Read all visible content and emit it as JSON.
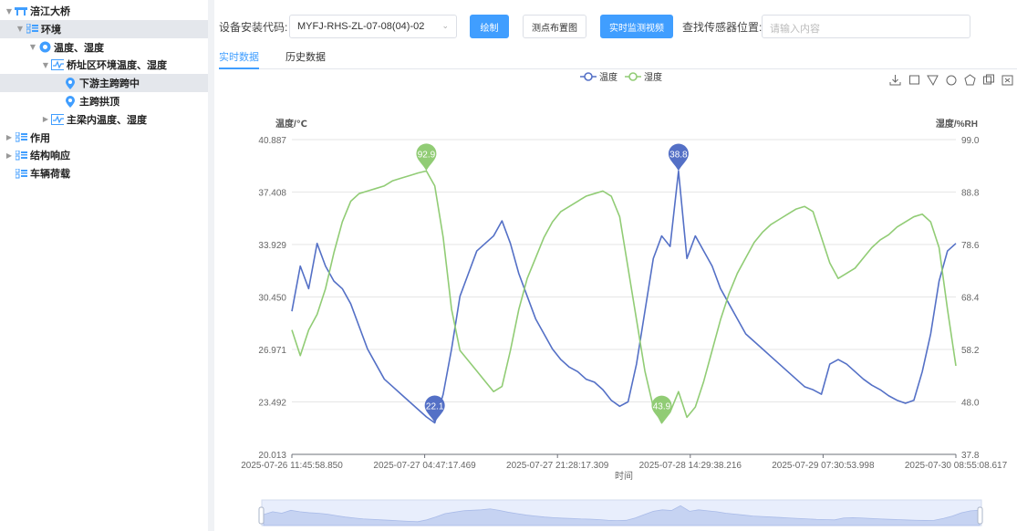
{
  "tree": [
    {
      "label": "涪江大桥",
      "level": 0,
      "caret": "▼",
      "icon": "bridge-icon",
      "selected": false
    },
    {
      "label": "环境",
      "level": 1,
      "caret": "▼",
      "icon": "list-icon",
      "selected": true
    },
    {
      "label": "温度、湿度",
      "level": 2,
      "caret": "▼",
      "icon": "thermo-hub-icon",
      "selected": false
    },
    {
      "label": "桥址区环境温度、湿度",
      "level": 3,
      "caret": "▼",
      "icon": "pulse-icon",
      "selected": false
    },
    {
      "label": "下游主跨跨中",
      "level": 4,
      "caret": "",
      "icon": "location-pin-icon",
      "selected": true
    },
    {
      "label": "主跨拱顶",
      "level": 4,
      "caret": "",
      "icon": "location-pin-icon",
      "selected": false
    },
    {
      "label": "主梁内温度、湿度",
      "level": 3,
      "caret": "▶",
      "icon": "pulse-icon",
      "selected": false
    },
    {
      "label": "作用",
      "level": 0,
      "caret": "▶",
      "icon": "list-icon",
      "selected": false
    },
    {
      "label": "结构响应",
      "level": 0,
      "caret": "▶",
      "icon": "list-icon",
      "selected": false
    },
    {
      "label": "车辆荷载",
      "level": 0,
      "caret": "",
      "icon": "list-icon",
      "selected": false
    }
  ],
  "toolbar": {
    "device_label": "设备安装代码:",
    "device_value": "MYFJ-RHS-ZL-07-08(04)-02",
    "draw_label": "绘制",
    "layout_label": "测点布置图",
    "video_label": "实时监测视频",
    "find_label": "查找传感器位置:",
    "search_placeholder": "请输入内容"
  },
  "tabs": [
    {
      "label": "实时数据",
      "active": true
    },
    {
      "label": "历史数据",
      "active": false
    }
  ],
  "colors": {
    "accent": "#409eff",
    "temp": "#5470c6",
    "humid": "#91cc75"
  },
  "chart_data": {
    "type": "line",
    "xlabel": "时间",
    "x_ticks": [
      "2025-07-26 11:45:58.850",
      "2025-07-27 04:47:17.469",
      "2025-07-27 21:28:17.309",
      "2025-07-28 14:29:38.216",
      "2025-07-29 07:30:53.998",
      "2025-07-30 08:55:08.617"
    ],
    "y_left": {
      "label": "温度/℃",
      "ylim": [
        20.013,
        40.887
      ],
      "ticks": [
        "20.013",
        "23.492",
        "26.971",
        "30.450",
        "33.929",
        "37.408",
        "40.887"
      ]
    },
    "y_right": {
      "label": "湿度/%RH",
      "ylim": [
        37.8,
        99.0
      ],
      "ticks": [
        "37.8",
        "48.0",
        "58.2",
        "68.4",
        "78.6",
        "88.8",
        "99.0"
      ]
    },
    "grid": true,
    "legend": "top-center",
    "series": [
      {
        "name": "温度",
        "axis": "left",
        "values": [
          29.5,
          32.5,
          31.0,
          34.0,
          32.5,
          31.5,
          31.0,
          30.0,
          28.5,
          27.0,
          26.0,
          25.0,
          24.5,
          24.0,
          23.5,
          23.0,
          22.5,
          22.1,
          24.0,
          27.0,
          30.5,
          32.0,
          33.5,
          34.0,
          34.5,
          35.5,
          34.0,
          32.0,
          30.5,
          29.0,
          28.0,
          27.0,
          26.3,
          25.8,
          25.5,
          25.0,
          24.8,
          24.3,
          23.6,
          23.2,
          23.5,
          26.0,
          29.5,
          33.0,
          34.5,
          33.8,
          38.8,
          33.0,
          34.5,
          33.5,
          32.5,
          31.0,
          30.0,
          29.0,
          28.0,
          27.5,
          27.0,
          26.5,
          26.0,
          25.5,
          25.0,
          24.5,
          24.3,
          24.0,
          26.0,
          26.3,
          26.0,
          25.5,
          25.0,
          24.6,
          24.3,
          23.9,
          23.6,
          23.4,
          23.6,
          25.5,
          28.0,
          31.5,
          33.5,
          34.0
        ]
      },
      {
        "name": "湿度",
        "axis": "right",
        "values": [
          62.0,
          57.0,
          62.0,
          65.0,
          70.0,
          77.0,
          83.0,
          87.0,
          88.5,
          89.0,
          89.5,
          90.0,
          91.0,
          91.5,
          92.0,
          92.5,
          92.9,
          90.0,
          80.0,
          66.0,
          58.0,
          56.0,
          54.0,
          52.0,
          50.0,
          51.0,
          58.0,
          66.0,
          72.0,
          76.0,
          80.0,
          83.0,
          85.0,
          86.0,
          87.0,
          88.0,
          88.5,
          89.0,
          88.0,
          84.0,
          74.0,
          64.0,
          54.0,
          47.0,
          43.9,
          46.0,
          50.0,
          45.0,
          47.0,
          52.0,
          58.0,
          64.0,
          69.0,
          73.0,
          76.0,
          79.0,
          81.0,
          82.5,
          83.5,
          84.5,
          85.5,
          86.0,
          85.0,
          80.0,
          75.0,
          72.0,
          73.0,
          74.0,
          76.0,
          78.0,
          79.5,
          80.5,
          82.0,
          83.0,
          84.0,
          84.5,
          83.0,
          78.0,
          66.0,
          55.0
        ]
      }
    ],
    "markers": [
      {
        "series": "湿度",
        "label": "92.9",
        "index": 16
      },
      {
        "series": "温度",
        "label": "22.1",
        "index": 17
      },
      {
        "series": "温度",
        "label": "38.8",
        "index": 46
      },
      {
        "series": "湿度",
        "label": "43.9",
        "index": 44
      }
    ]
  }
}
